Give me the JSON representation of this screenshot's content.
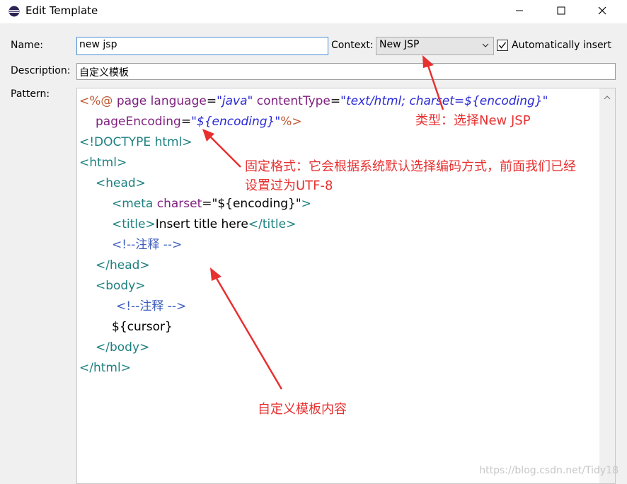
{
  "window": {
    "title": "Edit Template"
  },
  "form": {
    "name_label": "Name:",
    "name_value": "new jsp",
    "context_label": "Context:",
    "context_value": "New JSP",
    "auto_insert_label": "Automatically insert",
    "auto_insert_checked": true,
    "description_label": "Description:",
    "description_value": "自定义模板",
    "pattern_label": "Pattern:"
  },
  "pattern_lines": {
    "l1a": "<%@ ",
    "l1b": "page language",
    "l1c": "=",
    "l1d": "\"java\"",
    "l1e": " contentType",
    "l1f": "=",
    "l1g": "\"text/html; charset=${encoding}\"",
    "l2a": "pageEncoding",
    "l2b": "=",
    "l2c": "\"${encoding}\"",
    "l2d": "%>",
    "l3": "<!DOCTYPE html>",
    "l4": "<html>",
    "l5": "<head>",
    "l6a": "<meta ",
    "l6b": "charset",
    "l6c": "=",
    "l6d": "\"${encoding}\"",
    "l6e": ">",
    "l7a": "<title>",
    "l7b": "Insert title here",
    "l7c": "</title>",
    "l8": "<!--注释 -->",
    "l9": "</head>",
    "l10": "<body>",
    "l11": "<!--注释 -->",
    "l12": "${cursor}",
    "l13": "</body>",
    "l14": "</html>"
  },
  "annotations": {
    "type_note": "类型：选择New JSP",
    "format_note_1": "固定格式：它会根据系统默认选择编码方式，前面我们已经",
    "format_note_2": "设置过为UTF-8",
    "content_note": "自定义模板内容"
  },
  "watermark": "https://blog.csdn.net/Tidy18",
  "colors": {
    "annotation": "#e83030",
    "focus_border": "#4a90d9"
  },
  "icons": [
    "eclipse-icon",
    "minimize-icon",
    "maximize-icon",
    "close-icon",
    "chevron-down-icon",
    "checkmark-icon",
    "scroll-up-icon"
  ]
}
